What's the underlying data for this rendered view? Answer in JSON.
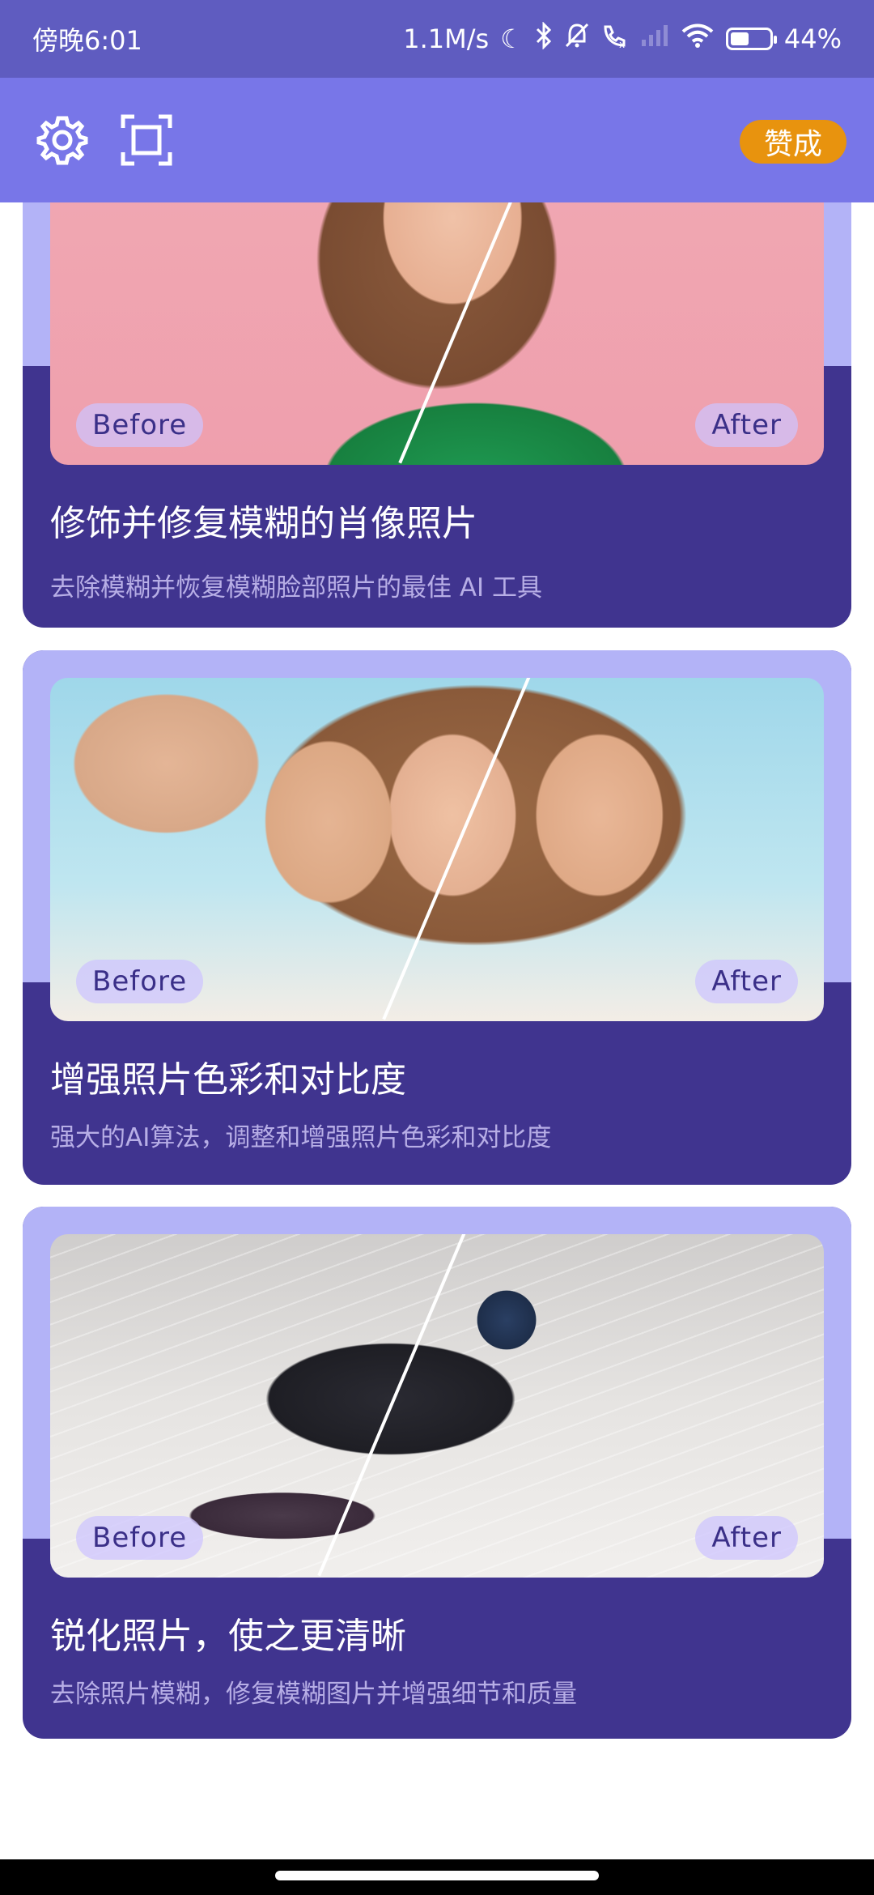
{
  "status_bar": {
    "time": "傍晚6:01",
    "network_speed": "1.1M/s",
    "battery_percent": "44%",
    "icons": [
      "moon-icon",
      "bluetooth-icon",
      "mute-bell-icon",
      "call-icon",
      "signal-icon",
      "wifi-icon",
      "battery-icon"
    ]
  },
  "app_bar": {
    "settings_icon": "gear-icon",
    "scan_icon": "scan-frame-icon",
    "upvote_label": "赞成",
    "upvote_color": "#e8930e",
    "background": "#7876e8"
  },
  "cards": [
    {
      "title": "修饰并修复模糊的肖像照片",
      "description": "去除模糊并恢复模糊脸部照片的最佳 AI 工具",
      "before_label": "Before",
      "after_label": "After"
    },
    {
      "title": "增强照片色彩和对比度",
      "description": "强大的AI算法，调整和增强照片色彩和对比度",
      "before_label": "Before",
      "after_label": "After"
    },
    {
      "title": "锐化照片，使之更清晰",
      "description": "去除照片模糊，修复模糊图片并增强细节和质量",
      "before_label": "Before",
      "after_label": "After"
    }
  ],
  "colors": {
    "card_bottom": "#40348f",
    "card_band": "#b3b3f7",
    "status_bar": "#5f5cc0"
  }
}
